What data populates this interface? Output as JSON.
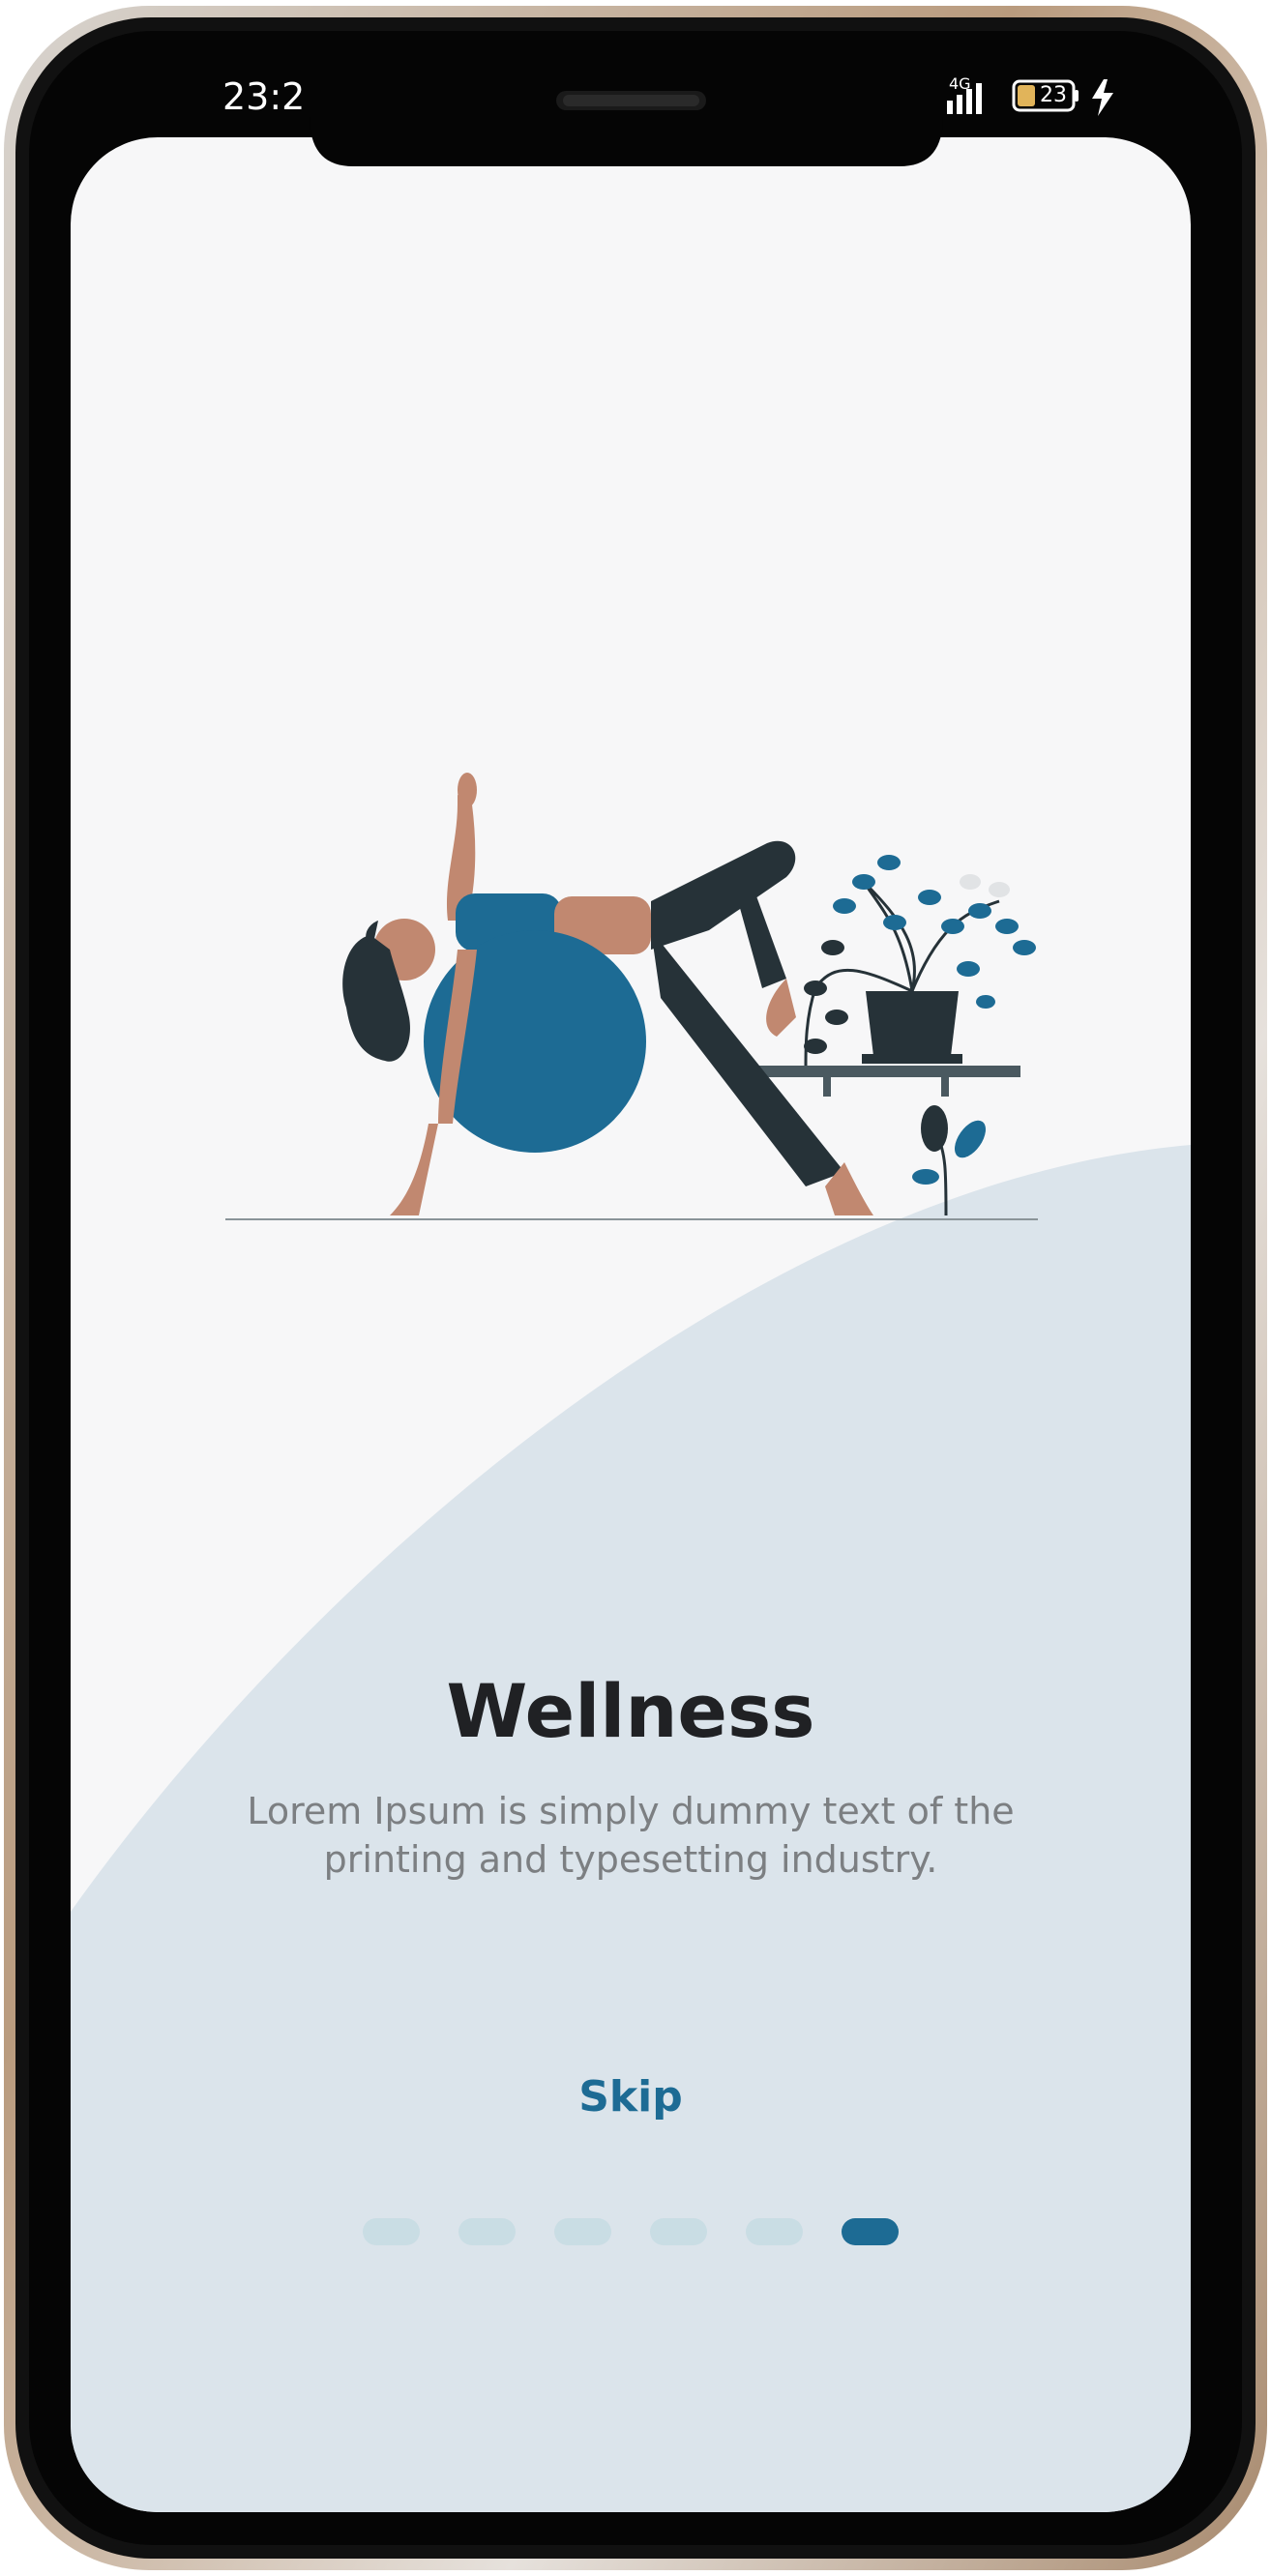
{
  "status_bar": {
    "time": "23:2",
    "network_label": "4G",
    "battery_level": "23"
  },
  "onboarding": {
    "title": "Wellness",
    "description": "Lorem Ipsum is simply dummy text of the printing and typesetting industry.",
    "skip_label": "Skip",
    "page_count": 6,
    "active_page": 6
  },
  "colors": {
    "accent": "#1d6b94",
    "background": "#f7f7f8",
    "wave": "#dbe4eb",
    "title": "#202124",
    "body_text": "#7c7f82",
    "dot_inactive": "#c9dde4"
  },
  "illustration": {
    "subject": "woman-stretching-on-exercise-ball",
    "items": [
      "exercise-ball",
      "potted-plant-on-shelf",
      "floor-plant"
    ]
  }
}
